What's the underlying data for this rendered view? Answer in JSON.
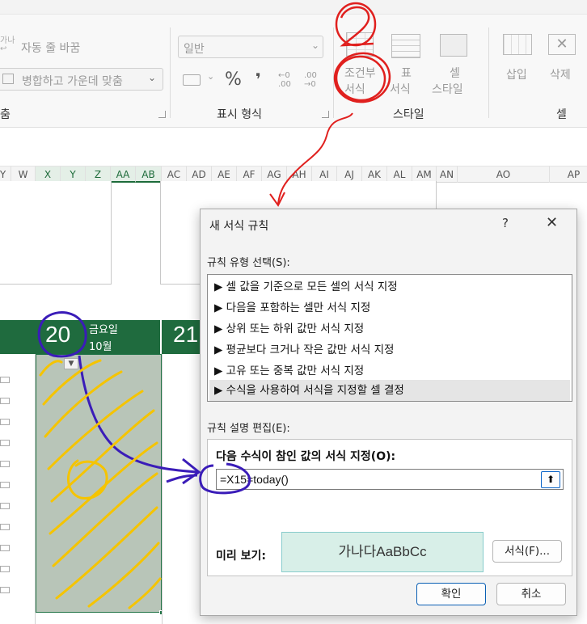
{
  "ribbon": {
    "wrap_text": "자동 줄 바꿈",
    "merge_center": "병합하고 가운데 맞춤",
    "alignment_group_fragment": "춤",
    "number_format_value": "일반",
    "number_group": "표시 형식",
    "percent_symbol": "%",
    "comma_symbol": "❜",
    "cond_format_line1": "조건부",
    "cond_format_line2": "서식",
    "format_table_line1": "표",
    "format_table_line2": "서식",
    "cell_styles_line1": "셀",
    "cell_styles_line2": "스타일",
    "styles_group": "스타일",
    "insert": "삽입",
    "delete": "삭제",
    "cells_group": "셀"
  },
  "columns": [
    "Y",
    "W",
    "X",
    "Y",
    "Z",
    "AA",
    "AB",
    "AC",
    "AD",
    "AE",
    "AF",
    "AG",
    "AH",
    "AI",
    "AJ",
    "AK",
    "AL",
    "AM",
    "AN",
    "AO",
    "AP"
  ],
  "calendar": {
    "day1_number": "20",
    "day1_name": "금요일",
    "day1_month": "10월",
    "day2_number": "21"
  },
  "dialog": {
    "title": "새 서식 규칙",
    "help": "?",
    "close": "✕",
    "rule_type_label": "규칙 유형 선택(S):",
    "rule_types": [
      "▶ 셀 값을 기준으로 모든 셀의 서식 지정",
      "▶ 다음을 포함하는 셀만 서식 지정",
      "▶ 상위 또는 하위 값만 서식 지정",
      "▶ 평균보다 크거나 작은 값만 서식 지정",
      "▶ 고유 또는 중복 값만 서식 지정",
      "▶ 수식을 사용하여 서식을 지정할 셀 결정"
    ],
    "edit_label": "규칙 설명 편집(E):",
    "formula_label": "다음 수식이 참인 값의 서식 지정(O):",
    "formula_value": "=X15=today()",
    "preview_label": "미리 보기:",
    "preview_text": "가나다AaBbCc",
    "format_button": "서식(F)...",
    "ok_button": "확인",
    "cancel_button": "취소"
  },
  "annotations": {
    "step_number": "2"
  },
  "colors": {
    "excel_green": "#1f6b3e",
    "annotation_red": "#e0201e",
    "annotation_purple": "#3a1cb8",
    "annotation_yellow": "#f5c400"
  }
}
